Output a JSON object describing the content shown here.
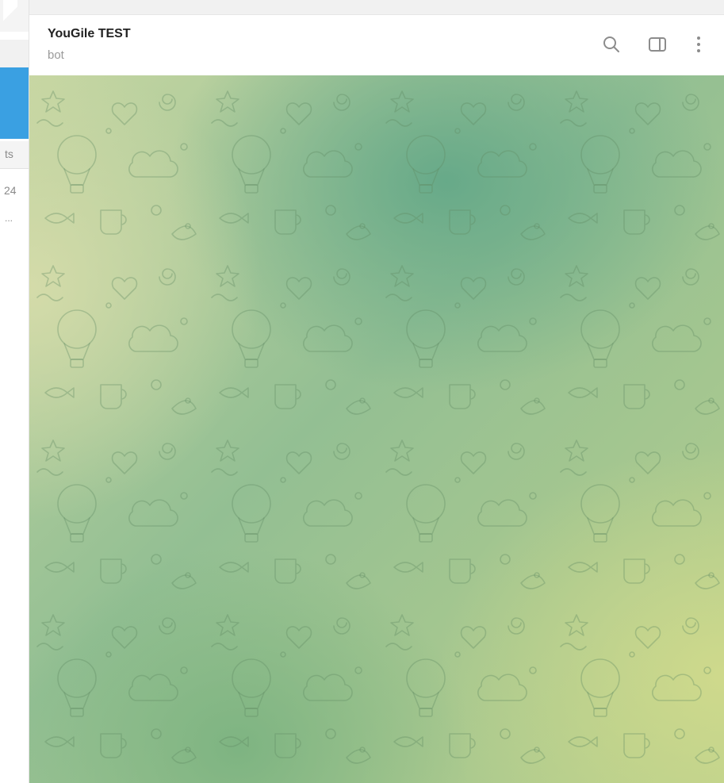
{
  "sidebar": {
    "snippets": [
      "ts",
      "24",
      "..."
    ]
  },
  "header": {
    "title": "YouGile TEST",
    "subtitle": "bot",
    "icons": [
      "search-icon",
      "sidebar-toggle-icon",
      "more-options-icon"
    ]
  },
  "chat": {
    "wallpaper": "doodle-pattern",
    "colors": {
      "accent": "#3aa0e2",
      "wallpaper_green": "#6fa883",
      "wallpaper_yellow": "#d0da8c"
    }
  }
}
